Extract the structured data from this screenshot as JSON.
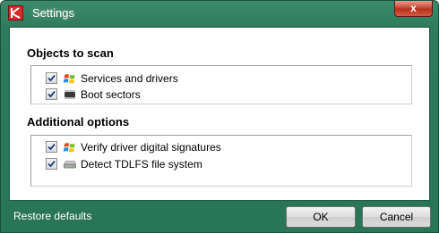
{
  "window": {
    "title": "Settings",
    "close_glyph": "x"
  },
  "sections": [
    {
      "title": "Objects to scan",
      "items": [
        {
          "label": "Services and drivers",
          "checked": true,
          "icon": "windows-flag-icon"
        },
        {
          "label": "Boot sectors",
          "checked": true,
          "icon": "chip-icon"
        }
      ]
    },
    {
      "title": "Additional options",
      "items": [
        {
          "label": "Verify driver digital signatures",
          "checked": true,
          "icon": "windows-flag-icon"
        },
        {
          "label": "Detect TDLFS file system",
          "checked": true,
          "icon": "hard-drive-icon"
        }
      ]
    }
  ],
  "footer": {
    "restore_label": "Restore defaults",
    "ok_label": "OK",
    "cancel_label": "Cancel"
  },
  "colors": {
    "frame": "#2e7a5c",
    "close_button": "#c74a36",
    "app_icon": "#d92b2b"
  }
}
